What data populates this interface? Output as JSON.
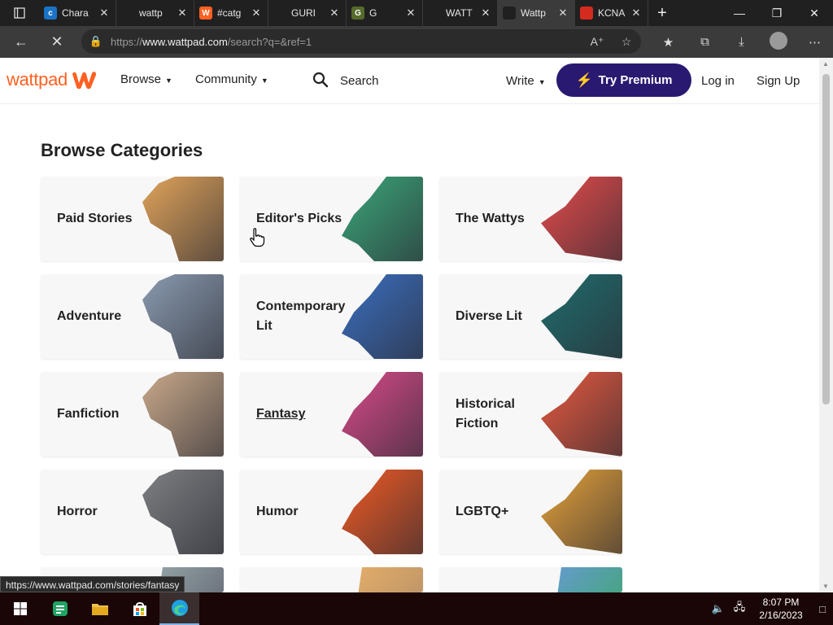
{
  "browser": {
    "tabs": [
      {
        "title": "Chara",
        "fav_letter": "c",
        "fav_color": "#1a73c8",
        "active": false
      },
      {
        "title": "wattp",
        "fav_letter": "",
        "fav_color": "#202020",
        "active": false
      },
      {
        "title": "#catg",
        "fav_letter": "W",
        "fav_color": "#ff6122",
        "active": false
      },
      {
        "title": "GURI",
        "fav_letter": "",
        "fav_color": "#202020",
        "active": false
      },
      {
        "title": "G",
        "fav_letter": "G",
        "fav_color": "#566b2b",
        "active": false
      },
      {
        "title": "WATT",
        "fav_letter": "",
        "fav_color": "#202020",
        "active": false
      },
      {
        "title": "Wattp",
        "fav_letter": "",
        "fav_color": "#202020",
        "active": true
      },
      {
        "title": "KCNA",
        "fav_letter": "",
        "fav_color": "#d52b1e",
        "active": false
      }
    ],
    "url_prefix": "https://",
    "url_host": "www.wattpad.com",
    "url_path": "/search?q=&ref=1",
    "status_url": "https://www.wattpad.com/stories/fantasy"
  },
  "header": {
    "logo_text": "wattpad",
    "browse": "Browse",
    "community": "Community",
    "search": "Search",
    "write": "Write",
    "premium": "Try Premium",
    "login": "Log in",
    "signup": "Sign Up"
  },
  "main": {
    "title": "Browse Categories",
    "categories": [
      {
        "label": "Paid Stories",
        "art": "#e0a35a"
      },
      {
        "label": "Editor's Picks",
        "art": "#3aa67a"
      },
      {
        "label": "The Wattys",
        "art": "#e64b4b"
      },
      {
        "label": "Adventure",
        "art": "#8a9bb0"
      },
      {
        "label": "Contemporary Lit",
        "art": "#3a6fc0"
      },
      {
        "label": "Diverse Lit",
        "art": "#1f6d6d"
      },
      {
        "label": "Fanfiction",
        "art": "#c9a98a"
      },
      {
        "label": "Fantasy",
        "art": "#d94a8a"
      },
      {
        "label": "Historical Fiction",
        "art": "#e8593f"
      },
      {
        "label": "Horror",
        "art": "#7d7f82"
      },
      {
        "label": "Humor",
        "art": "#f05a24"
      },
      {
        "label": "LGBTQ+",
        "art": "#e6a23a"
      }
    ]
  },
  "taskbar": {
    "time": "8:07 PM",
    "date": "2/16/2023"
  }
}
